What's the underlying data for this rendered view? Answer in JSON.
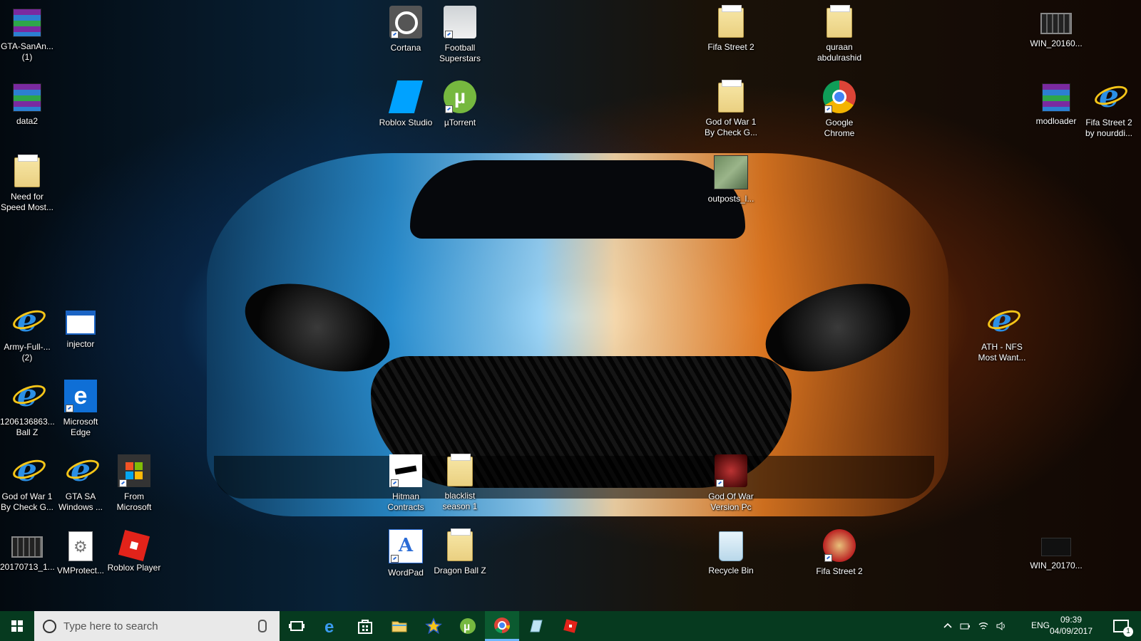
{
  "desktop": {
    "icons": [
      {
        "label": "GTA-SanAn... (1)",
        "glyph": "winrar-archive-icon"
      },
      {
        "label": "data2",
        "glyph": "winrar-archive-icon"
      },
      {
        "label": "Need for Speed Most...",
        "glyph": "folder-icon"
      },
      {
        "label": "Army-Full-... (2)",
        "glyph": "internet-explorer-icon"
      },
      {
        "label": "injector",
        "glyph": "application-window-icon"
      },
      {
        "label": "1206136863... Ball Z",
        "glyph": "internet-explorer-icon"
      },
      {
        "label": "Microsoft Edge",
        "glyph": "edge-icon"
      },
      {
        "label": "God of War 1 By Check G...",
        "glyph": "internet-explorer-icon"
      },
      {
        "label": "GTA SA Windows ...",
        "glyph": "internet-explorer-icon"
      },
      {
        "label": "From Microsoft",
        "glyph": "microsoft-store-icon"
      },
      {
        "label": "20170713_1...",
        "glyph": "video-file-icon"
      },
      {
        "label": "VMProtect...",
        "glyph": "settings-file-icon"
      },
      {
        "label": "Roblox Player",
        "glyph": "roblox-icon"
      },
      {
        "label": "Cortana",
        "glyph": "cortana-icon"
      },
      {
        "label": "Football Superstars",
        "glyph": "football-superstars-icon"
      },
      {
        "label": "Roblox Studio",
        "glyph": "roblox-studio-icon"
      },
      {
        "label": "µTorrent",
        "glyph": "utorrent-icon"
      },
      {
        "label": "Hitman Contracts",
        "glyph": "hitman-icon"
      },
      {
        "label": "blacklist season 1",
        "glyph": "folder-icon"
      },
      {
        "label": "WordPad",
        "glyph": "wordpad-icon"
      },
      {
        "label": "Dragon Ball Z",
        "glyph": "folder-icon"
      },
      {
        "label": "Fifa Street 2",
        "glyph": "folder-icon"
      },
      {
        "label": "God of War 1 By Check G...",
        "glyph": "folder-icon"
      },
      {
        "label": "outposts_l...",
        "glyph": "map-image-icon"
      },
      {
        "label": "God Of War Version Pc",
        "glyph": "god-of-war-icon"
      },
      {
        "label": "Recycle Bin",
        "glyph": "recycle-bin-icon"
      },
      {
        "label": "quraan abdulrashid",
        "glyph": "folder-icon"
      },
      {
        "label": "Google Chrome",
        "glyph": "chrome-icon"
      },
      {
        "label": "Fifa Street 2",
        "glyph": "fifa-street-icon"
      },
      {
        "label": "ATH - NFS Most Want...",
        "glyph": "internet-explorer-icon"
      },
      {
        "label": "WIN_20160...",
        "glyph": "video-file-icon"
      },
      {
        "label": "modloader",
        "glyph": "winrar-archive-icon"
      },
      {
        "label": "Fifa Street 2 by nourddi...",
        "glyph": "internet-explorer-icon"
      },
      {
        "label": "WIN_20170...",
        "glyph": "video-file-icon"
      }
    ]
  },
  "taskbar": {
    "search_placeholder": "Type here to search",
    "apps": [
      {
        "name": "task-view-icon",
        "active": false
      },
      {
        "name": "edge-icon",
        "active": false
      },
      {
        "name": "microsoft-store-icon",
        "active": false
      },
      {
        "name": "file-explorer-icon",
        "active": false
      },
      {
        "name": "star-app-icon",
        "active": false
      },
      {
        "name": "utorrent-icon",
        "active": false
      },
      {
        "name": "chrome-icon",
        "active": true
      },
      {
        "name": "paint-icon",
        "active": false
      },
      {
        "name": "roblox-icon",
        "active": false
      }
    ],
    "tray": {
      "language": "ENG",
      "time": "09:39",
      "date": "04/09/2017",
      "notification_count": "1"
    }
  }
}
